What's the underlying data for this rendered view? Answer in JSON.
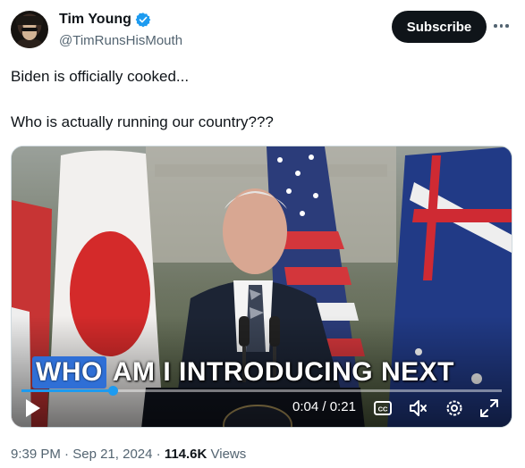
{
  "author": {
    "display_name": "Tim Young",
    "handle": "@TimRunsHisMouth",
    "verified": true
  },
  "actions": {
    "subscribe_label": "Subscribe"
  },
  "tweet": {
    "lines": [
      "Biden is officially cooked...",
      "Who is actually running our country???"
    ]
  },
  "video": {
    "caption_highlight": "WHO",
    "caption_rest": "AM I INTRODUCING NEXT",
    "current_time": "0:04",
    "separator": " / ",
    "duration": "0:21",
    "progress_fraction": 0.19
  },
  "meta": {
    "time": "9:39 PM",
    "dot": " · ",
    "date": "Sep 21, 2024",
    "views_count": "114.6K",
    "views_label": " Views"
  },
  "colors": {
    "accent": "#1d9bf0",
    "caption_highlight": "#2f6fd6",
    "text_primary": "#0f1419",
    "text_secondary": "#536471"
  },
  "icons": [
    "verified-badge-icon",
    "more-options-icon",
    "play-icon",
    "closed-captions-icon",
    "mute-icon",
    "settings-gear-icon",
    "fullscreen-icon"
  ]
}
